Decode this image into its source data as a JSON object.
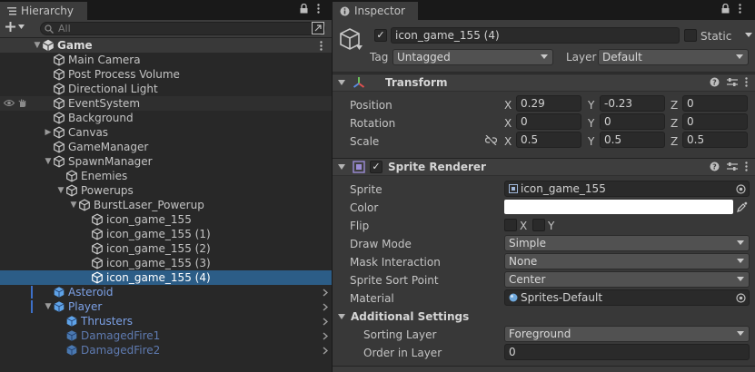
{
  "hierarchy": {
    "tab_title": "Hierarchy",
    "search_placeholder": "All",
    "rows": [
      {
        "label": "Game",
        "depth": 0,
        "expanded": true,
        "kind": "scene"
      },
      {
        "label": "Main Camera",
        "depth": 1,
        "kind": "go"
      },
      {
        "label": "Post Process Volume",
        "depth": 1,
        "kind": "go"
      },
      {
        "label": "Directional Light",
        "depth": 1,
        "kind": "go"
      },
      {
        "label": "EventSystem",
        "depth": 1,
        "kind": "go"
      },
      {
        "label": "Background",
        "depth": 1,
        "kind": "go"
      },
      {
        "label": "Canvas",
        "depth": 1,
        "kind": "go",
        "collapsed": true
      },
      {
        "label": "GameManager",
        "depth": 1,
        "kind": "go"
      },
      {
        "label": "SpawnManager",
        "depth": 1,
        "kind": "go",
        "expanded": true
      },
      {
        "label": "Enemies",
        "depth": 2,
        "kind": "go"
      },
      {
        "label": "Powerups",
        "depth": 2,
        "kind": "go",
        "expanded": true
      },
      {
        "label": "BurstLaser_Powerup",
        "depth": 3,
        "kind": "go",
        "expanded": true
      },
      {
        "label": "icon_game_155",
        "depth": 4,
        "kind": "go"
      },
      {
        "label": "icon_game_155 (1)",
        "depth": 4,
        "kind": "go"
      },
      {
        "label": "icon_game_155 (2)",
        "depth": 4,
        "kind": "go"
      },
      {
        "label": "icon_game_155 (3)",
        "depth": 4,
        "kind": "go"
      },
      {
        "label": "icon_game_155 (4)",
        "depth": 4,
        "kind": "go",
        "selected": true
      },
      {
        "label": "Asteroid",
        "depth": 1,
        "kind": "prefab"
      },
      {
        "label": "Player",
        "depth": 1,
        "kind": "prefab",
        "expanded": true
      },
      {
        "label": "Thrusters",
        "depth": 2,
        "kind": "prefab"
      },
      {
        "label": "DamagedFire1",
        "depth": 2,
        "kind": "prefab-faded"
      },
      {
        "label": "DamagedFire2",
        "depth": 2,
        "kind": "prefab-faded"
      }
    ]
  },
  "inspector": {
    "tab_title": "Inspector",
    "object_name": "icon_game_155 (4)",
    "static_label": "Static",
    "tag_label": "Tag",
    "tag_value": "Untagged",
    "layer_label": "Layer",
    "layer_value": "Default",
    "transform": {
      "title": "Transform",
      "position_label": "Position",
      "rotation_label": "Rotation",
      "scale_label": "Scale",
      "position": {
        "x": "0.29",
        "y": "-0.23",
        "z": "0"
      },
      "rotation": {
        "x": "0",
        "y": "0",
        "z": "0"
      },
      "scale": {
        "x": "0.5",
        "y": "0.5",
        "z": "0.5"
      },
      "axis_x": "X",
      "axis_y": "Y",
      "axis_z": "Z"
    },
    "sprite_renderer": {
      "title": "Sprite Renderer",
      "sprite_label": "Sprite",
      "sprite_value": "icon_game_155",
      "color_label": "Color",
      "color_value": "#ffffff",
      "flip_label": "Flip",
      "flip_x": "X",
      "flip_y": "Y",
      "draw_mode_label": "Draw Mode",
      "draw_mode_value": "Simple",
      "mask_label": "Mask Interaction",
      "mask_value": "None",
      "sort_point_label": "Sprite Sort Point",
      "sort_point_value": "Center",
      "material_label": "Material",
      "material_value": "Sprites-Default",
      "additional_label": "Additional Settings",
      "sorting_layer_label": "Sorting Layer",
      "sorting_layer_value": "Foreground",
      "order_label": "Order in Layer",
      "order_value": "0"
    }
  },
  "colors": {
    "selection": "#2c5d87",
    "prefab_text": "#7ca1e6",
    "panel": "#383838"
  }
}
